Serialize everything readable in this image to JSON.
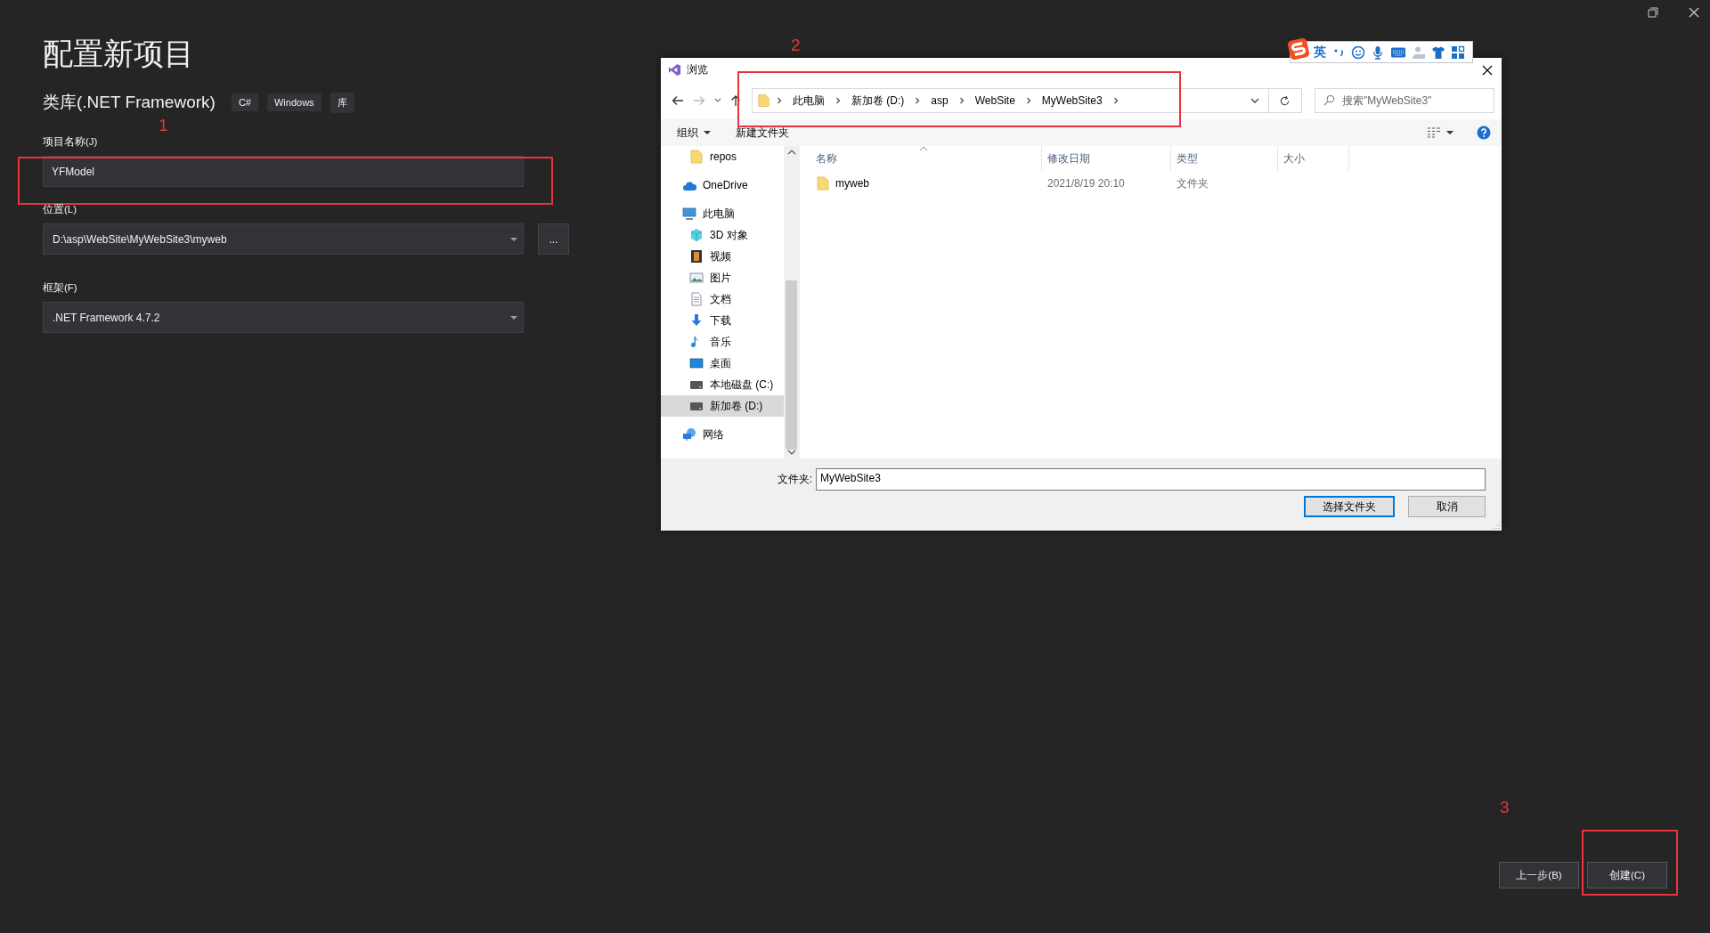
{
  "page": {
    "title": "配置新项目"
  },
  "project_type": {
    "name": "类库(.NET Framework)",
    "tags": [
      "C#",
      "Windows",
      "库"
    ]
  },
  "fields": [
    {
      "label": "项目名称(J)",
      "value": "YFModel",
      "kind": "text"
    },
    {
      "label": "位置(L)",
      "value": "D:\\asp\\WebSite\\MyWebSite3\\myweb",
      "kind": "combo",
      "browse_button": "..."
    },
    {
      "label": "框架(F)",
      "value": ".NET Framework 4.7.2",
      "kind": "combo"
    }
  ],
  "footer_buttons": [
    "上一步(B)",
    "创建(C)"
  ],
  "annotations": [
    "1",
    "2",
    "3"
  ],
  "ime_bar": {
    "mode": "英"
  },
  "dialog": {
    "title": "浏览",
    "breadcrumb": [
      "此电脑",
      "新加卷 (D:)",
      "asp",
      "WebSite",
      "MyWebSite3"
    ],
    "search": {
      "placeholder": "搜索\"MyWebSite3\""
    },
    "toolbar": [
      "组织",
      "新建文件夹"
    ],
    "nav": [
      {
        "label": "repos",
        "kind": "folder",
        "selected": false
      },
      {
        "label": "OneDrive",
        "kind": "cloud",
        "selected": false
      },
      {
        "label": "此电脑",
        "kind": "pc",
        "selected": false,
        "children": [
          {
            "label": "3D 对象",
            "kind": "cube",
            "selected": false
          },
          {
            "label": "视频",
            "kind": "film",
            "selected": false
          },
          {
            "label": "图片",
            "kind": "image",
            "selected": false
          },
          {
            "label": "文档",
            "kind": "doc",
            "selected": false
          },
          {
            "label": "下载",
            "kind": "download",
            "selected": false
          },
          {
            "label": "音乐",
            "kind": "music",
            "selected": false
          },
          {
            "label": "桌面",
            "kind": "desktop",
            "selected": false
          },
          {
            "label": "本地磁盘 (C:)",
            "kind": "drive",
            "selected": false
          },
          {
            "label": "新加卷 (D:)",
            "kind": "drive",
            "selected": true
          }
        ]
      },
      {
        "label": "网络",
        "kind": "network",
        "selected": false
      }
    ],
    "columns": [
      "名称",
      "修改日期",
      "类型",
      "大小"
    ],
    "rows": [
      {
        "name": "myweb",
        "modified": "2021/8/19 20:10",
        "type": "文件夹"
      }
    ],
    "folder_label": "文件夹:",
    "folder_value": "MyWebSite3",
    "buttons": [
      {
        "label": "选择文件夹",
        "default": true
      },
      {
        "label": "取消",
        "default": false
      }
    ]
  }
}
